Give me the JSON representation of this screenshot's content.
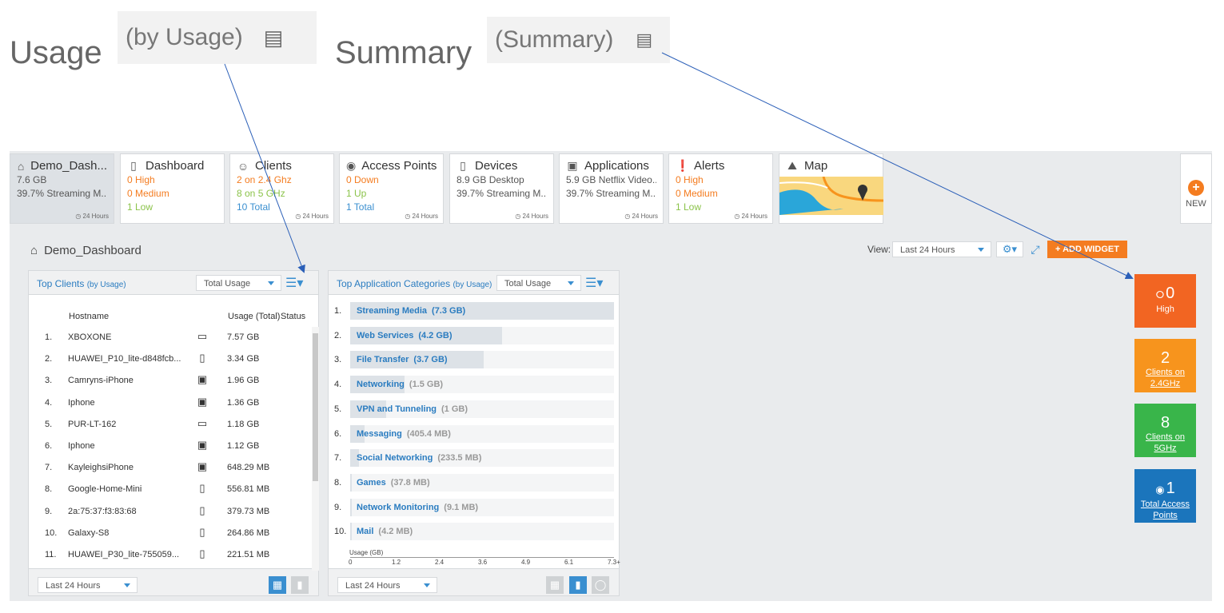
{
  "annotations": {
    "usage_word": "Usage",
    "usage_box": "(by Usage)",
    "summary_word": "Summary",
    "summary_box": "(Summary)"
  },
  "tiles": [
    {
      "title": "Demo_Dash...",
      "icon": "home-icon",
      "lines": [
        "7.6 GB",
        "39.7% Streaming M..."
      ],
      "stamp": "24 Hours"
    },
    {
      "title": "Dashboard",
      "icon": "tablet-icon",
      "lines": [
        "0 High",
        "0 Medium",
        "1 Low"
      ]
    },
    {
      "title": "Clients",
      "icon": "clients-icon",
      "lines": [
        "2 on 2.4 Ghz",
        "8 on 5 GHz",
        "10 Total"
      ],
      "stamp": "24 Hours"
    },
    {
      "title": "Access Points",
      "icon": "access-point-icon",
      "lines": [
        "0 Down",
        "1 Up",
        "1 Total"
      ],
      "stamp": "24 Hours"
    },
    {
      "title": "Devices",
      "icon": "device-icon",
      "lines": [
        "8.9 GB Desktop",
        "39.7% Streaming M..."
      ],
      "stamp": "24 Hours"
    },
    {
      "title": "Applications",
      "icon": "window-icon",
      "lines": [
        "5.9 GB Netflix Video...",
        "39.7% Streaming M..."
      ],
      "stamp": "24 Hours"
    },
    {
      "title": "Alerts",
      "icon": "alert-icon",
      "lines": [
        "0 High",
        "0 Medium",
        "1 Low"
      ],
      "stamp": "24 Hours"
    },
    {
      "title": "Map",
      "icon": "map-icon"
    }
  ],
  "new_tile": {
    "label": "NEW"
  },
  "dashboard": {
    "title": "Demo_Dashboard",
    "view_label": "View:",
    "view_value": "Last 24 Hours",
    "add_widget": "+ ADD WIDGET"
  },
  "top_clients": {
    "title": "Top Clients",
    "subtitle": "(by Usage)",
    "metric": "Total Usage",
    "col_hostname": "Hostname",
    "col_usage": "Usage (Total)",
    "col_status": "Status",
    "rows": [
      {
        "n": "1.",
        "host": "XBOXONE",
        "device": "monitor",
        "usage": "7.57 GB"
      },
      {
        "n": "2.",
        "host": "HUAWEI_P10_lite-d848fcb...",
        "device": "phone",
        "usage": "3.34 GB"
      },
      {
        "n": "3.",
        "host": "Camryns-iPhone",
        "device": "tablet",
        "usage": "1.96 GB"
      },
      {
        "n": "4.",
        "host": "Iphone",
        "device": "tablet",
        "usage": "1.36 GB"
      },
      {
        "n": "5.",
        "host": "PUR-LT-162",
        "device": "monitor",
        "usage": "1.18 GB"
      },
      {
        "n": "6.",
        "host": "Iphone",
        "device": "tablet",
        "usage": "1.12 GB"
      },
      {
        "n": "7.",
        "host": "KayleighsiPhone",
        "device": "tablet",
        "usage": "648.29 MB"
      },
      {
        "n": "8.",
        "host": "Google-Home-Mini",
        "device": "phone",
        "usage": "556.81 MB"
      },
      {
        "n": "9.",
        "host": "2a:75:37:f3:83:68",
        "device": "phone",
        "usage": "379.73 MB"
      },
      {
        "n": "10.",
        "host": "Galaxy-S8",
        "device": "phone",
        "usage": "264.86 MB"
      },
      {
        "n": "11.",
        "host": "HUAWEI_P30_lite-755059...",
        "device": "phone",
        "usage": "221.51 MB"
      }
    ],
    "footer_range": "Last 24 Hours"
  },
  "top_apps": {
    "title": "Top Application Categories",
    "subtitle": "(by Usage)",
    "metric": "Total Usage",
    "footer_range": "Last 24 Hours",
    "axis_label": "Usage (GB)",
    "ticks": [
      "0",
      "1.2",
      "2.4",
      "3.6",
      "4.9",
      "6.1",
      "7.3+"
    ]
  },
  "chart_data": {
    "type": "bar",
    "orientation": "horizontal",
    "xlabel": "Usage (GB)",
    "xlim": [
      0,
      7.3
    ],
    "categories": [
      "Streaming Media",
      "Web Services",
      "File Transfer",
      "Networking",
      "VPN and Tunneling",
      "Messaging",
      "Social Networking",
      "Games",
      "Network Monitoring",
      "Mail"
    ],
    "value_labels": [
      "(7.3 GB)",
      "(4.2 GB)",
      "(3.7 GB)",
      "(1.5 GB)",
      "(1 GB)",
      "(405.4 MB)",
      "(233.5 MB)",
      "(37.8 MB)",
      "(9.1 MB)",
      "(4.2 MB)"
    ],
    "values": [
      7.3,
      4.2,
      3.7,
      1.5,
      1.0,
      0.4054,
      0.2335,
      0.0378,
      0.0091,
      0.0042
    ]
  },
  "summary_cards": [
    {
      "value": "0",
      "label": "High",
      "color": "#f26522"
    },
    {
      "value": "2",
      "label": "Clients on 2.4GHz",
      "color": "#f7941d"
    },
    {
      "value": "8",
      "label": "Clients on 5GHz",
      "color": "#39b54a"
    },
    {
      "value": "1",
      "label": "Total Access Points",
      "color": "#1b75bc"
    }
  ]
}
